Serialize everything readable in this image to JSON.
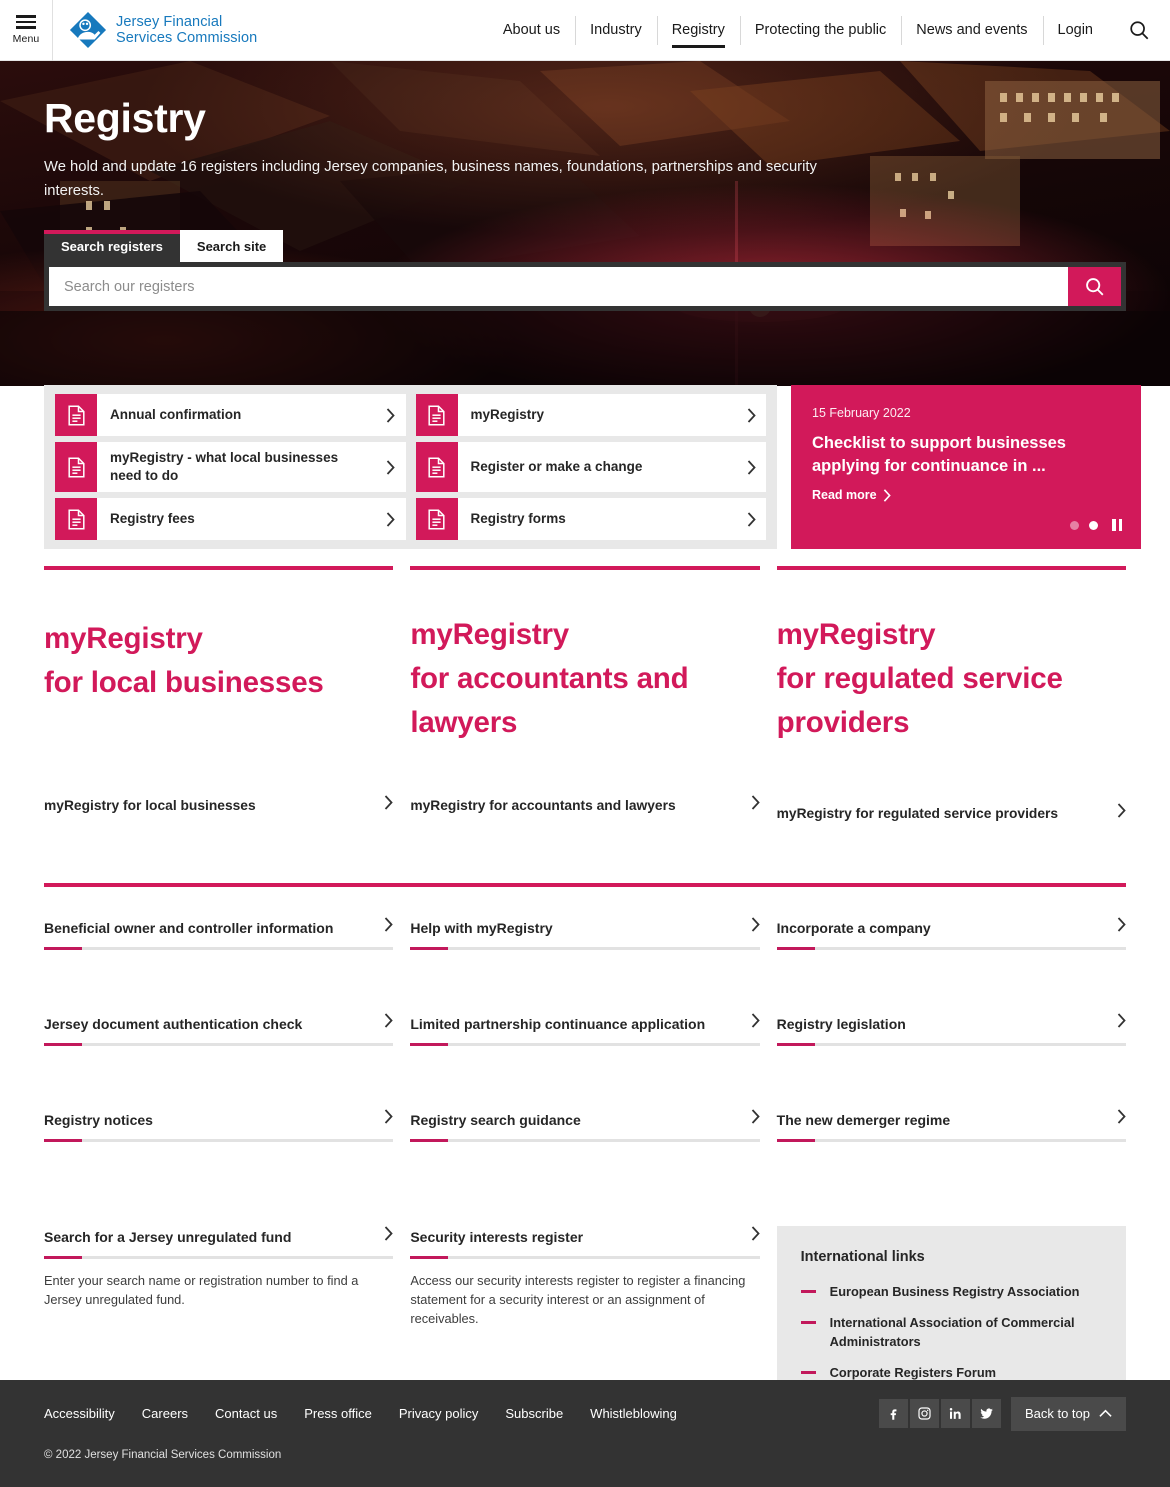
{
  "brand": {
    "logo_line1": "Jersey Financial",
    "logo_line2": "Services Commission",
    "logo_text": "Jersey Financial\nServices Commission",
    "accent": "#d2195a",
    "accent_dark": "#c2185b",
    "logo_blue": "#1779bd"
  },
  "header": {
    "menu_label": "Menu",
    "menu_icon": "hamburger-icon",
    "search_icon": "search-icon",
    "nav": [
      {
        "label": "About us",
        "active": false
      },
      {
        "label": "Industry",
        "active": false
      },
      {
        "label": "Registry",
        "active": true
      },
      {
        "label": "Protecting the public",
        "active": false
      },
      {
        "label": "News and events",
        "active": false
      },
      {
        "label": "Login",
        "active": false
      }
    ]
  },
  "hero": {
    "title": "Registry",
    "subtitle": "We hold and update 16 registers including Jersey companies, business names, foundations, partnerships and security interests.",
    "tabs": [
      {
        "label": "Search registers",
        "active": true
      },
      {
        "label": "Search site",
        "active": false
      }
    ],
    "search": {
      "value": "",
      "placeholder": "Search our registers",
      "button_icon": "search-icon"
    }
  },
  "quicklinks": {
    "icon": "document-icon",
    "chevron": "chevron-right-icon",
    "items": [
      "Annual confirmation",
      "myRegistry",
      "myRegistry - what local businesses need to do",
      "Register or make a change",
      "Registry fees",
      "Registry forms"
    ]
  },
  "news": {
    "date": "15 February 2022",
    "headline": "Checklist to support businesses applying for continuance in ...",
    "read_more": "Read more",
    "read_more_icon": "chevron-right-icon",
    "slides_total": 2,
    "slide_active_index": 1,
    "pause_icon": "pause-icon"
  },
  "promos": [
    {
      "title": "myRegistry\nfor local businesses",
      "link_label": "myRegistry for local businesses",
      "chevron": "chevron-right-icon"
    },
    {
      "title": "myRegistry\nfor accountants and lawyers",
      "link_label": "myRegistry for accountants and lawyers",
      "chevron": "chevron-right-icon"
    },
    {
      "title": "myRegistry\nfor regulated service providers",
      "link_label": "myRegistry for regulated service providers",
      "chevron": "chevron-right-icon"
    }
  ],
  "link_cards": [
    {
      "label": "Beneficial owner and controller information",
      "desc": ""
    },
    {
      "label": "Help with myRegistry",
      "desc": ""
    },
    {
      "label": "Incorporate a company",
      "desc": ""
    },
    {
      "label": "Jersey document authentication check",
      "desc": ""
    },
    {
      "label": "Limited partnership continuance application",
      "desc": ""
    },
    {
      "label": "Registry legislation",
      "desc": ""
    },
    {
      "label": "Registry notices",
      "desc": ""
    },
    {
      "label": "Registry search guidance",
      "desc": ""
    },
    {
      "label": "The new demerger regime",
      "desc": ""
    }
  ],
  "bottom_cards": [
    {
      "label": "Search for a Jersey unregulated fund",
      "desc": "Enter your search name or registration number to find a Jersey unregulated fund."
    },
    {
      "label": "Security interests register",
      "desc": "Access our security interests register to register a financing statement for a security interest or an assignment of receivables."
    }
  ],
  "international": {
    "title": "International links",
    "items": [
      "European Business Registry Association",
      "International Association of Commercial Administrators",
      "Corporate Registers Forum"
    ]
  },
  "footer": {
    "links": [
      "Accessibility",
      "Careers",
      "Contact us",
      "Press office",
      "Privacy policy",
      "Subscribe",
      "Whistleblowing"
    ],
    "social": [
      {
        "name": "facebook-icon"
      },
      {
        "name": "instagram-icon"
      },
      {
        "name": "linkedin-icon"
      },
      {
        "name": "twitter-icon"
      }
    ],
    "back_to_top": "Back to top",
    "back_to_top_icon": "chevron-up-icon",
    "copyright": "© 2022 Jersey Financial Services Commission"
  }
}
